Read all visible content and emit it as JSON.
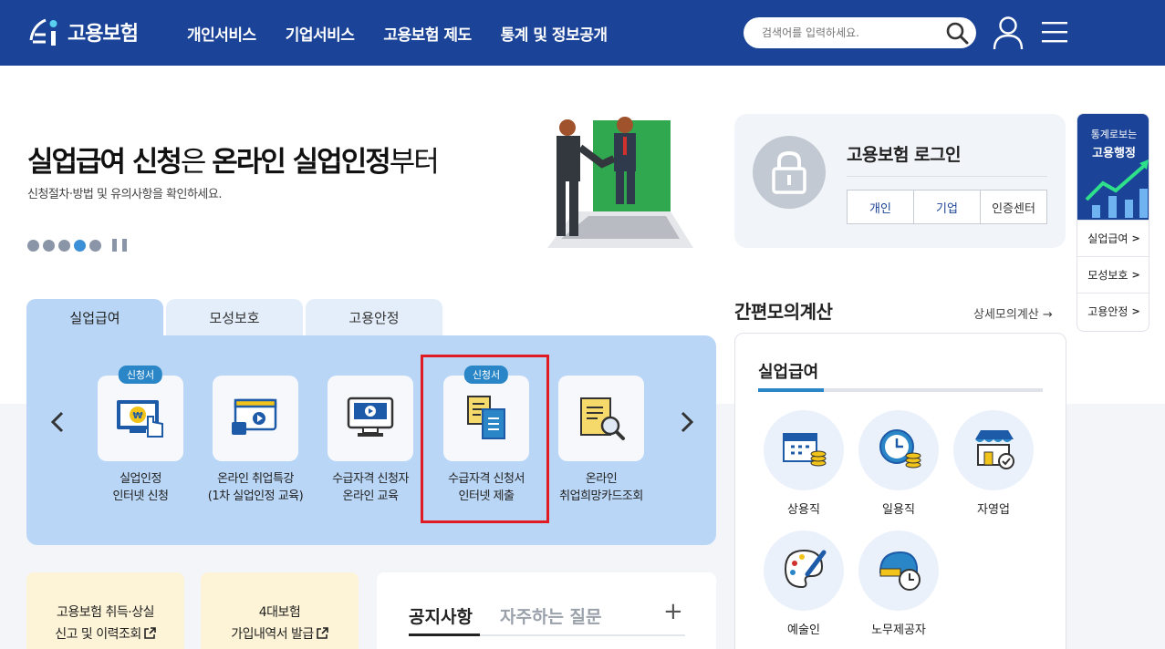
{
  "header": {
    "logo_text": "고용보험",
    "nav": [
      "개인서비스",
      "기업서비스",
      "고용보험 제도",
      "통계 및 정보공개"
    ],
    "search_placeholder": "검색어를 입력하세요."
  },
  "hero": {
    "title_bold1": "실업급여 신청",
    "title_light1": "은 ",
    "title_bold2": "온라인 실업인정",
    "title_light2": "부터",
    "subtitle": "신청절차·방법 및 유의사항을 확인하세요.",
    "slide_count": 5,
    "active_slide": 4
  },
  "login": {
    "title": "고용보험 로그인",
    "buttons": [
      "개인",
      "기업",
      "인증센터"
    ]
  },
  "quick": {
    "head_small": "통계로보는",
    "head_big": "고용행정",
    "items": [
      "실업급여",
      "모성보호",
      "고용안정"
    ]
  },
  "tabs": [
    "실업급여",
    "모성보호",
    "고용안정"
  ],
  "services": [
    {
      "badge": "신청서",
      "line1": "실업인정",
      "line2": "인터넷 신청",
      "icon": "monitor-won-hand-icon"
    },
    {
      "badge": "",
      "line1": "온라인 취업특강",
      "line2": "(1차 실업인정 교육)",
      "icon": "video-lecture-icon"
    },
    {
      "badge": "",
      "line1": "수급자격 신청자",
      "line2": "온라인 교육",
      "icon": "monitor-play-icon"
    },
    {
      "badge": "신청서",
      "line1": "수급자격 신청서",
      "line2": "인터넷 제출",
      "icon": "documents-icon"
    },
    {
      "badge": "",
      "line1": "온라인",
      "line2": "취업희망카드조회",
      "icon": "document-search-icon"
    }
  ],
  "cards": [
    {
      "line1": "고용보험 취득·상실",
      "line2": "신고 및 이력조회"
    },
    {
      "line1": "4대보험",
      "line2": "가입내역서 발급"
    }
  ],
  "notice": {
    "tab1": "공지사항",
    "tab2": "자주하는 질문",
    "plus": "+"
  },
  "calc": {
    "title": "간편모의계산",
    "more": "상세모의계산",
    "subtitle": "실업급여",
    "items": [
      "상용직",
      "일용직",
      "자영업",
      "예술인",
      "노무제공자"
    ]
  },
  "colors": {
    "header": "#1b4397",
    "accent": "#2a86c6",
    "panel": "#b9d6f6",
    "highlight": "#e01b22"
  }
}
